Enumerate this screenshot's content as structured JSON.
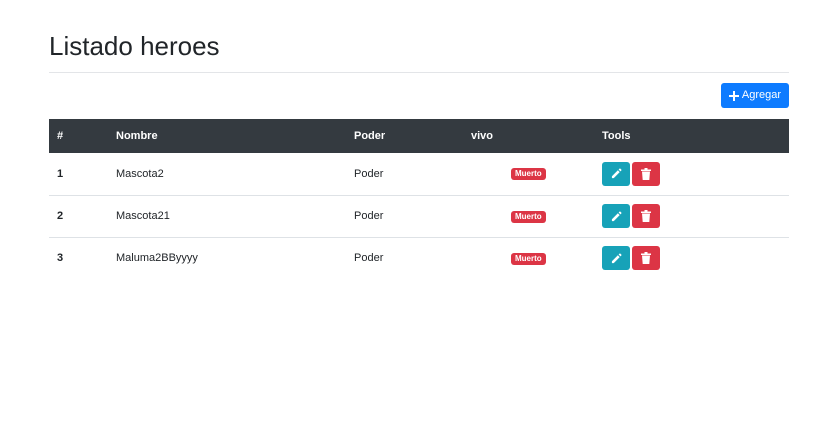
{
  "page": {
    "title": "Listado heroes"
  },
  "toolbar": {
    "add_label": "Agregar",
    "add_icon": "plus-icon"
  },
  "table": {
    "headers": [
      "#",
      "Nombre",
      "Poder",
      "vivo",
      "Tools"
    ],
    "rows": [
      {
        "num": "1",
        "nombre": "Mascota2",
        "poder": "Poder",
        "estado": "Muerto"
      },
      {
        "num": "2",
        "nombre": "Mascota21",
        "poder": "Poder",
        "estado": "Muerto"
      },
      {
        "num": "3",
        "nombre": "Maluma2BByyyy",
        "poder": "Poder",
        "estado": "Muerto"
      }
    ],
    "tools_icons": [
      "pencil-icon",
      "trash-icon"
    ]
  },
  "colors": {
    "primary": "#0d7bff",
    "header_dark": "#343a40",
    "info": "#17a2b8",
    "danger": "#dc3545"
  }
}
